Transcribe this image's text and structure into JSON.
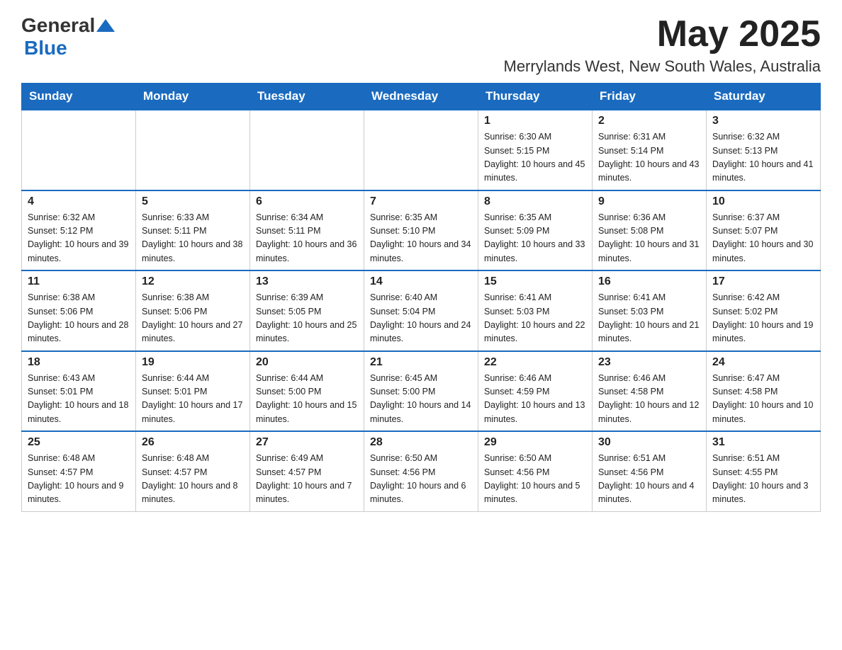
{
  "header": {
    "logo_general": "General",
    "logo_blue": "Blue",
    "month": "May 2025",
    "location": "Merrylands West, New South Wales, Australia"
  },
  "days_of_week": [
    "Sunday",
    "Monday",
    "Tuesday",
    "Wednesday",
    "Thursday",
    "Friday",
    "Saturday"
  ],
  "weeks": [
    [
      {
        "day": "",
        "sunrise": "",
        "sunset": "",
        "daylight": ""
      },
      {
        "day": "",
        "sunrise": "",
        "sunset": "",
        "daylight": ""
      },
      {
        "day": "",
        "sunrise": "",
        "sunset": "",
        "daylight": ""
      },
      {
        "day": "",
        "sunrise": "",
        "sunset": "",
        "daylight": ""
      },
      {
        "day": "1",
        "sunrise": "Sunrise: 6:30 AM",
        "sunset": "Sunset: 5:15 PM",
        "daylight": "Daylight: 10 hours and 45 minutes."
      },
      {
        "day": "2",
        "sunrise": "Sunrise: 6:31 AM",
        "sunset": "Sunset: 5:14 PM",
        "daylight": "Daylight: 10 hours and 43 minutes."
      },
      {
        "day": "3",
        "sunrise": "Sunrise: 6:32 AM",
        "sunset": "Sunset: 5:13 PM",
        "daylight": "Daylight: 10 hours and 41 minutes."
      }
    ],
    [
      {
        "day": "4",
        "sunrise": "Sunrise: 6:32 AM",
        "sunset": "Sunset: 5:12 PM",
        "daylight": "Daylight: 10 hours and 39 minutes."
      },
      {
        "day": "5",
        "sunrise": "Sunrise: 6:33 AM",
        "sunset": "Sunset: 5:11 PM",
        "daylight": "Daylight: 10 hours and 38 minutes."
      },
      {
        "day": "6",
        "sunrise": "Sunrise: 6:34 AM",
        "sunset": "Sunset: 5:11 PM",
        "daylight": "Daylight: 10 hours and 36 minutes."
      },
      {
        "day": "7",
        "sunrise": "Sunrise: 6:35 AM",
        "sunset": "Sunset: 5:10 PM",
        "daylight": "Daylight: 10 hours and 34 minutes."
      },
      {
        "day": "8",
        "sunrise": "Sunrise: 6:35 AM",
        "sunset": "Sunset: 5:09 PM",
        "daylight": "Daylight: 10 hours and 33 minutes."
      },
      {
        "day": "9",
        "sunrise": "Sunrise: 6:36 AM",
        "sunset": "Sunset: 5:08 PM",
        "daylight": "Daylight: 10 hours and 31 minutes."
      },
      {
        "day": "10",
        "sunrise": "Sunrise: 6:37 AM",
        "sunset": "Sunset: 5:07 PM",
        "daylight": "Daylight: 10 hours and 30 minutes."
      }
    ],
    [
      {
        "day": "11",
        "sunrise": "Sunrise: 6:38 AM",
        "sunset": "Sunset: 5:06 PM",
        "daylight": "Daylight: 10 hours and 28 minutes."
      },
      {
        "day": "12",
        "sunrise": "Sunrise: 6:38 AM",
        "sunset": "Sunset: 5:06 PM",
        "daylight": "Daylight: 10 hours and 27 minutes."
      },
      {
        "day": "13",
        "sunrise": "Sunrise: 6:39 AM",
        "sunset": "Sunset: 5:05 PM",
        "daylight": "Daylight: 10 hours and 25 minutes."
      },
      {
        "day": "14",
        "sunrise": "Sunrise: 6:40 AM",
        "sunset": "Sunset: 5:04 PM",
        "daylight": "Daylight: 10 hours and 24 minutes."
      },
      {
        "day": "15",
        "sunrise": "Sunrise: 6:41 AM",
        "sunset": "Sunset: 5:03 PM",
        "daylight": "Daylight: 10 hours and 22 minutes."
      },
      {
        "day": "16",
        "sunrise": "Sunrise: 6:41 AM",
        "sunset": "Sunset: 5:03 PM",
        "daylight": "Daylight: 10 hours and 21 minutes."
      },
      {
        "day": "17",
        "sunrise": "Sunrise: 6:42 AM",
        "sunset": "Sunset: 5:02 PM",
        "daylight": "Daylight: 10 hours and 19 minutes."
      }
    ],
    [
      {
        "day": "18",
        "sunrise": "Sunrise: 6:43 AM",
        "sunset": "Sunset: 5:01 PM",
        "daylight": "Daylight: 10 hours and 18 minutes."
      },
      {
        "day": "19",
        "sunrise": "Sunrise: 6:44 AM",
        "sunset": "Sunset: 5:01 PM",
        "daylight": "Daylight: 10 hours and 17 minutes."
      },
      {
        "day": "20",
        "sunrise": "Sunrise: 6:44 AM",
        "sunset": "Sunset: 5:00 PM",
        "daylight": "Daylight: 10 hours and 15 minutes."
      },
      {
        "day": "21",
        "sunrise": "Sunrise: 6:45 AM",
        "sunset": "Sunset: 5:00 PM",
        "daylight": "Daylight: 10 hours and 14 minutes."
      },
      {
        "day": "22",
        "sunrise": "Sunrise: 6:46 AM",
        "sunset": "Sunset: 4:59 PM",
        "daylight": "Daylight: 10 hours and 13 minutes."
      },
      {
        "day": "23",
        "sunrise": "Sunrise: 6:46 AM",
        "sunset": "Sunset: 4:58 PM",
        "daylight": "Daylight: 10 hours and 12 minutes."
      },
      {
        "day": "24",
        "sunrise": "Sunrise: 6:47 AM",
        "sunset": "Sunset: 4:58 PM",
        "daylight": "Daylight: 10 hours and 10 minutes."
      }
    ],
    [
      {
        "day": "25",
        "sunrise": "Sunrise: 6:48 AM",
        "sunset": "Sunset: 4:57 PM",
        "daylight": "Daylight: 10 hours and 9 minutes."
      },
      {
        "day": "26",
        "sunrise": "Sunrise: 6:48 AM",
        "sunset": "Sunset: 4:57 PM",
        "daylight": "Daylight: 10 hours and 8 minutes."
      },
      {
        "day": "27",
        "sunrise": "Sunrise: 6:49 AM",
        "sunset": "Sunset: 4:57 PM",
        "daylight": "Daylight: 10 hours and 7 minutes."
      },
      {
        "day": "28",
        "sunrise": "Sunrise: 6:50 AM",
        "sunset": "Sunset: 4:56 PM",
        "daylight": "Daylight: 10 hours and 6 minutes."
      },
      {
        "day": "29",
        "sunrise": "Sunrise: 6:50 AM",
        "sunset": "Sunset: 4:56 PM",
        "daylight": "Daylight: 10 hours and 5 minutes."
      },
      {
        "day": "30",
        "sunrise": "Sunrise: 6:51 AM",
        "sunset": "Sunset: 4:56 PM",
        "daylight": "Daylight: 10 hours and 4 minutes."
      },
      {
        "day": "31",
        "sunrise": "Sunrise: 6:51 AM",
        "sunset": "Sunset: 4:55 PM",
        "daylight": "Daylight: 10 hours and 3 minutes."
      }
    ]
  ]
}
